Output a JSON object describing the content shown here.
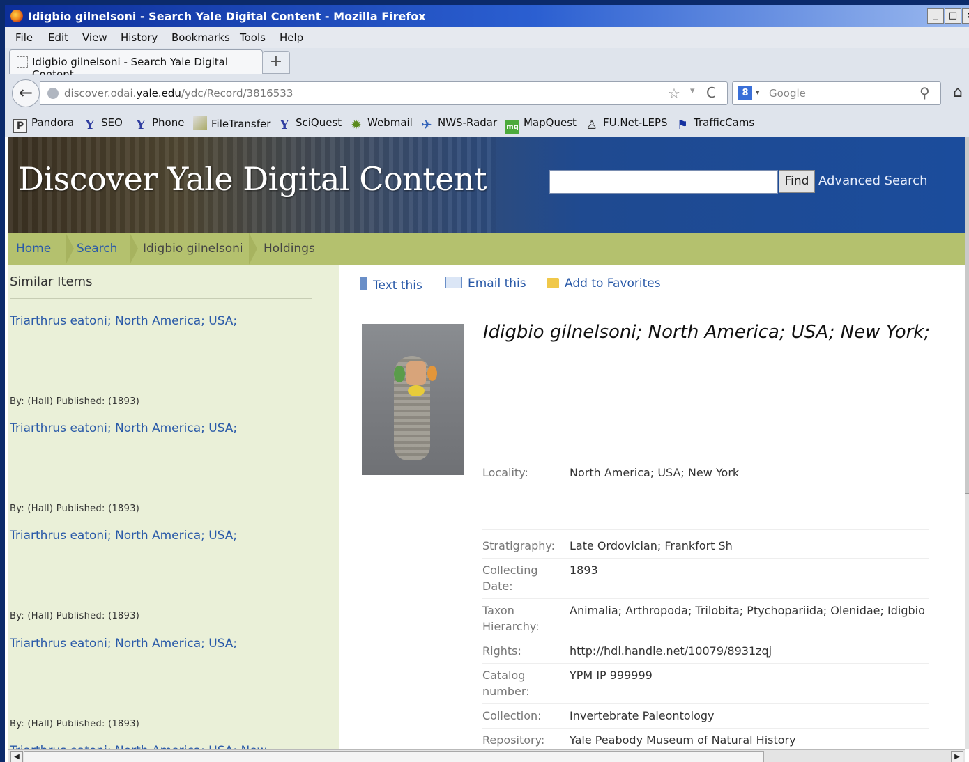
{
  "window": {
    "title": "Idigbio gilnelsoni - Search Yale Digital Content - Mozilla Firefox",
    "controls": [
      "_",
      "□",
      "×"
    ]
  },
  "menu": [
    "File",
    "Edit",
    "View",
    "History",
    "Bookmarks",
    "Tools",
    "Help"
  ],
  "tab": {
    "title": "Idigbio gilnelsoni - Search Yale Digital Content",
    "new_tab_label": "+"
  },
  "nav": {
    "back_icon": "←",
    "url_prefix": "discover.odai.",
    "url_host": "yale.edu",
    "url_path": "/ydc/Record/3816533",
    "star_icon": "☆",
    "dropdown_icon": "▾",
    "reload_icon": "C",
    "search_engine_icon": "8",
    "search_dropdown": "▾",
    "search_placeholder": "Google",
    "magnifier_icon": "⚲",
    "home_icon": "⌂"
  },
  "bookmarks": [
    {
      "label": "Pandora",
      "icon": "P",
      "icon_name": "pandora-icon"
    },
    {
      "label": "SEO",
      "icon": "Y",
      "icon_name": "yahoo-icon"
    },
    {
      "label": "Phone",
      "icon": "Y",
      "icon_name": "yahoo-icon"
    },
    {
      "label": "FileTransfer",
      "icon": "",
      "icon_name": "filetransfer-icon"
    },
    {
      "label": "SciQuest",
      "icon": "Y",
      "icon_name": "yahoo-icon"
    },
    {
      "label": "Webmail",
      "icon": "✹",
      "icon_name": "webmail-icon"
    },
    {
      "label": "NWS-Radar",
      "icon": "✈",
      "icon_name": "radar-icon"
    },
    {
      "label": "MapQuest",
      "icon": "mq",
      "icon_name": "mapquest-icon"
    },
    {
      "label": "FU.Net-LEPS",
      "icon": "♙",
      "icon_name": "linux-penguin-icon"
    },
    {
      "label": "TrafficCams",
      "icon": "⚑",
      "icon_name": "flag-icon"
    }
  ],
  "site": {
    "title": "Discover Yale Digital Content",
    "search_value": "",
    "find_label": "Find",
    "advanced_label": "Advanced Search"
  },
  "breadcrumbs": [
    "Home",
    "Search",
    "Idigbio gilnelsoni",
    "Holdings"
  ],
  "sidebar": {
    "heading": "Similar Items",
    "items": [
      {
        "title": "Triarthrus eatoni; North America; USA;",
        "byline": "By: (Hall) Published: (1893)"
      },
      {
        "title": "Triarthrus eatoni; North America; USA;",
        "byline": "By: (Hall) Published: (1893)"
      },
      {
        "title": "Triarthrus eatoni; North America; USA;",
        "byline": "By: (Hall) Published: (1893)"
      },
      {
        "title": "Triarthrus eatoni; North America; USA;",
        "byline": "By: (Hall) Published: (1893)"
      },
      {
        "title": "Triarthrus eatoni; North America; USA; New",
        "byline": ""
      }
    ]
  },
  "actions": [
    "Text this",
    "Email this",
    "Add to Favorites"
  ],
  "record": {
    "title": "Idigbio gilnelsoni; North America; USA; New York;",
    "fields": [
      {
        "label": "Locality:",
        "value": "North America; USA; New York"
      },
      {
        "label": "Stratigraphy:",
        "value": "Late Ordovician; Frankfort Sh"
      },
      {
        "label": "Collecting Date:",
        "value": "1893"
      },
      {
        "label": "Taxon Hierarchy:",
        "value": "Animalia; Arthropoda; Trilobita; Ptychopariida; Olenidae; Idigbio"
      },
      {
        "label": "Rights:",
        "value": "http://hdl.handle.net/10079/8931zqj"
      },
      {
        "label": "Catalog number:",
        "value": "YPM IP 999999"
      },
      {
        "label": "Collection:",
        "value": "Invertebrate Paleontology"
      },
      {
        "label": "Repository:",
        "value": "Yale Peabody Museum of Natural History"
      }
    ]
  },
  "scrollbar": {
    "left_arrow": "◀",
    "right_arrow": "▶"
  }
}
